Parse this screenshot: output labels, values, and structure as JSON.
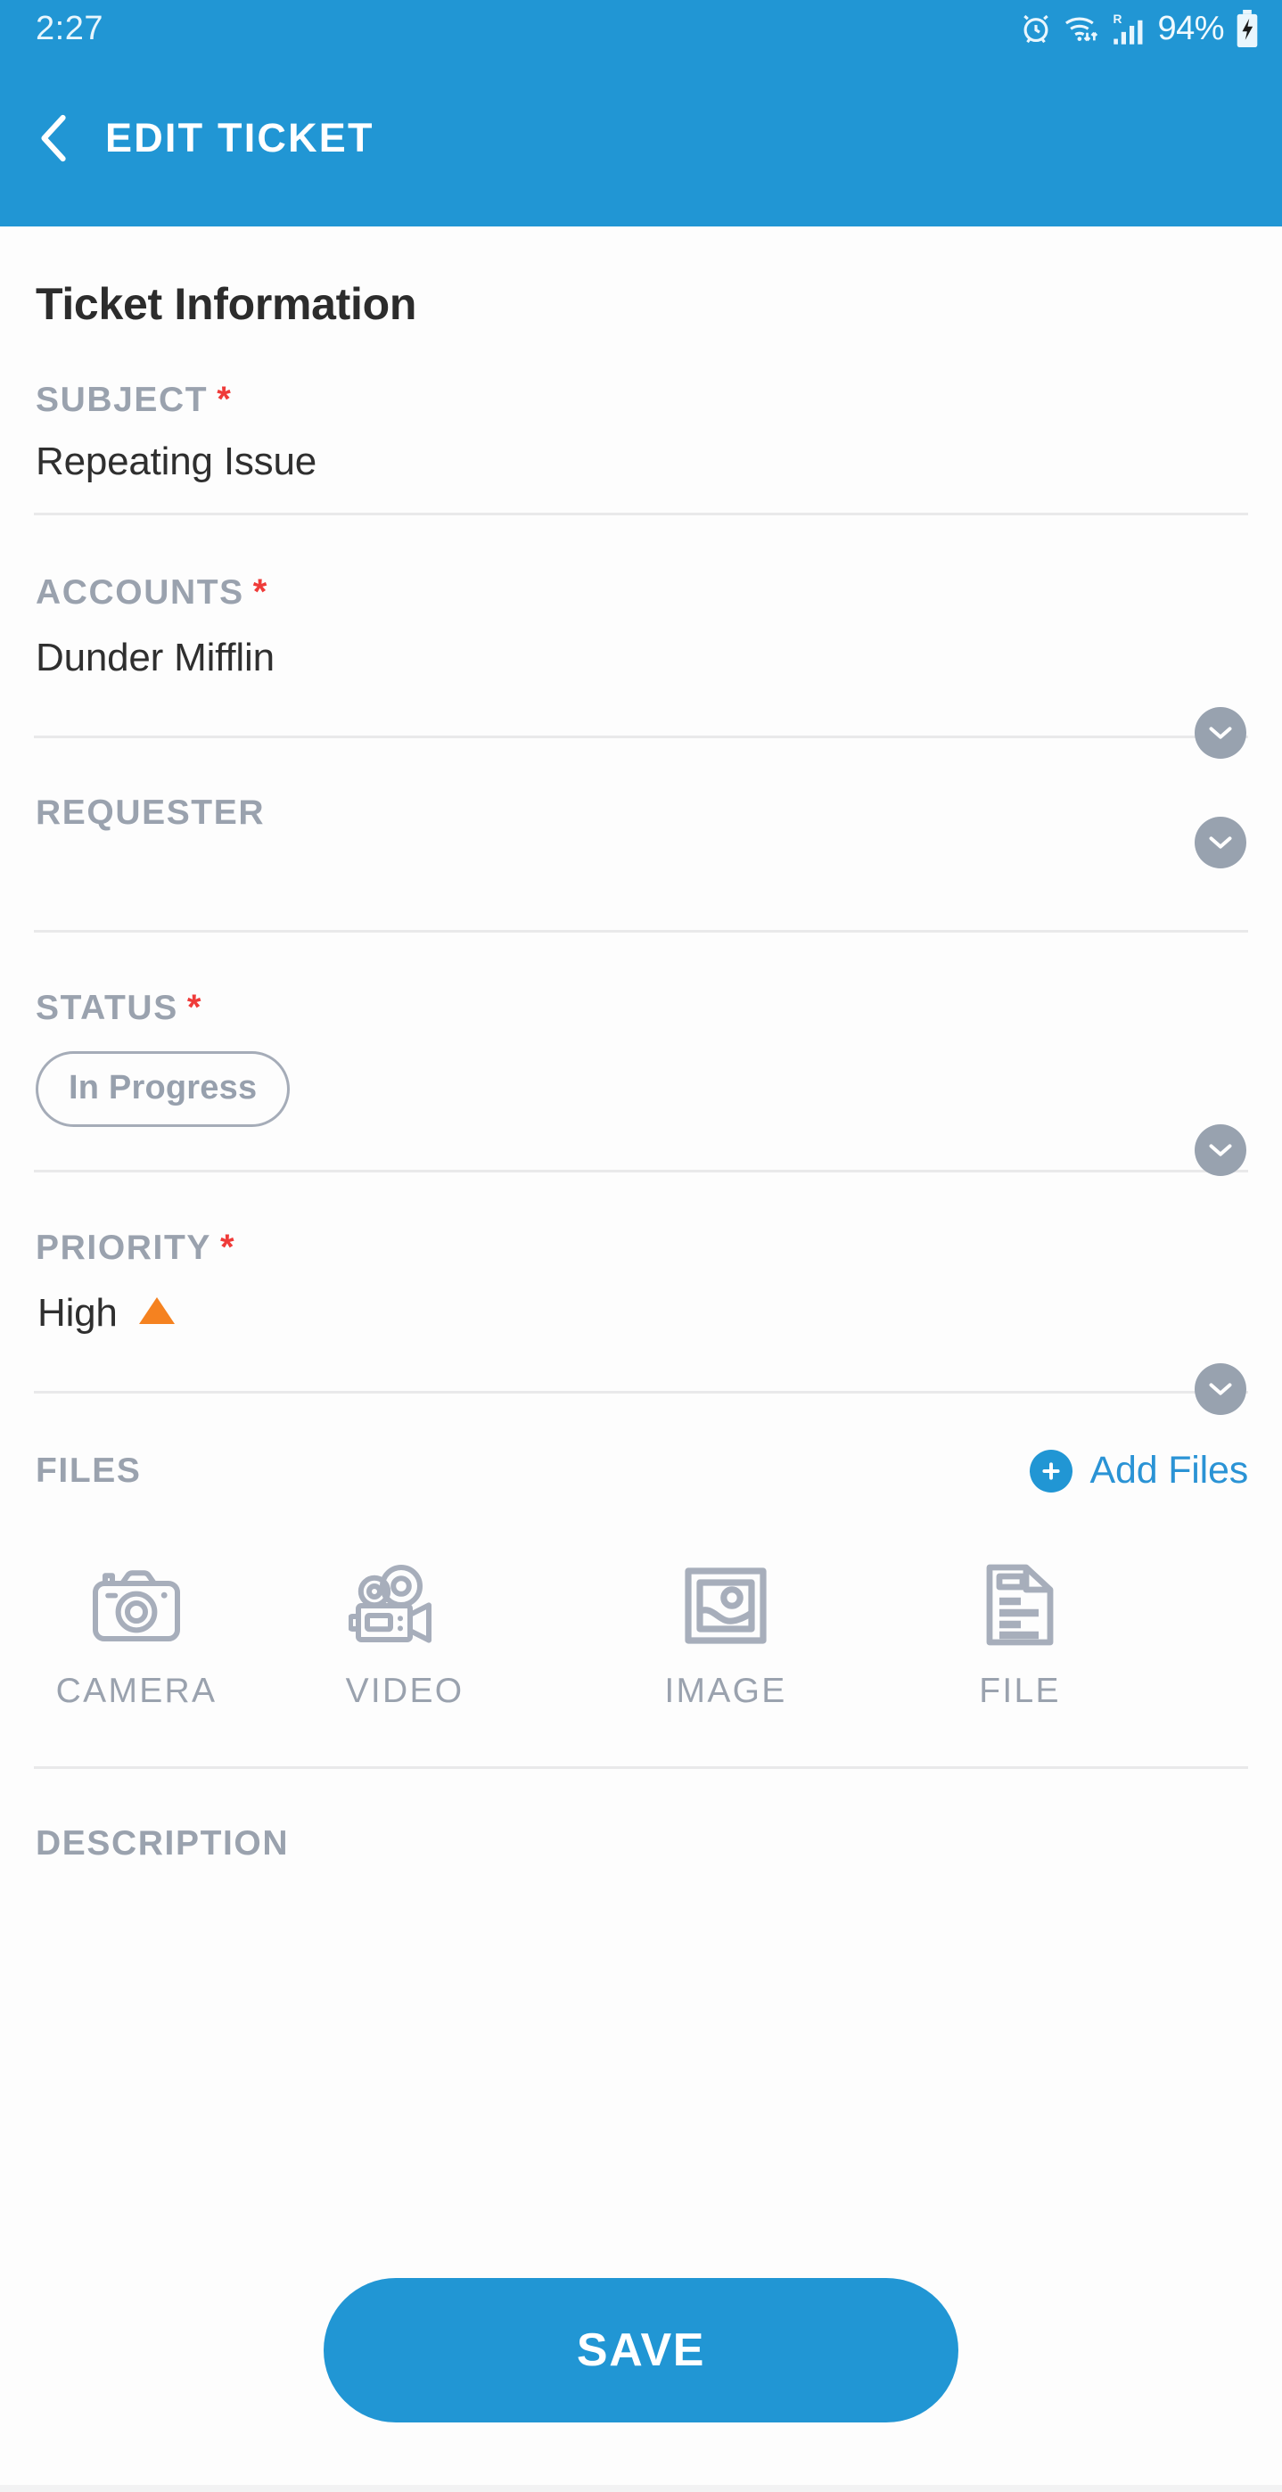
{
  "statusbar": {
    "time": "2:27",
    "battery_percent": "94%",
    "icons": [
      "alarm-clock-icon",
      "wifi-icon",
      "roaming-signal-icon",
      "battery-charging-icon"
    ],
    "roaming_letter": "R"
  },
  "appbar": {
    "title": "EDIT TICKET",
    "back_icon": "chevron-left-icon",
    "bg_color": "#2196d4"
  },
  "main": {
    "section_title": "Ticket Information",
    "required_marker": "*",
    "fields": [
      {
        "label": "SUBJECT",
        "required": true,
        "value": "Repeating Issue",
        "dropdown": false
      },
      {
        "label": "ACCOUNTS",
        "required": true,
        "value": "Dunder Mifflin",
        "dropdown": true
      },
      {
        "label": "REQUESTER",
        "required": false,
        "value": "",
        "dropdown": true
      },
      {
        "label": "STATUS",
        "required": true,
        "value": "In Progress",
        "dropdown": true,
        "style": "pill"
      },
      {
        "label": "PRIORITY",
        "required": true,
        "value": "High",
        "dropdown": true,
        "indicator": "priority-up-arrow",
        "indicator_color": "#f58220"
      }
    ],
    "files": {
      "label": "FILES",
      "add_label": "Add Files",
      "add_icon": "plus-circle-icon",
      "accent_color": "#2196d4",
      "types": [
        {
          "label": "CAMERA",
          "icon": "camera-icon"
        },
        {
          "label": "VIDEO",
          "icon": "video-camera-icon"
        },
        {
          "label": "IMAGE",
          "icon": "image-icon"
        },
        {
          "label": "FILE",
          "icon": "document-icon"
        }
      ]
    },
    "description": {
      "label": "DESCRIPTION",
      "value": ""
    }
  },
  "footer": {
    "save_label": "SAVE"
  },
  "colors": {
    "accent": "#2196d4",
    "label_gray": "#9aa2ae",
    "value_dark": "#2f2f2f",
    "required_red": "#ef3b39",
    "divider": "#e9e9ea",
    "priority_orange": "#f58220"
  }
}
